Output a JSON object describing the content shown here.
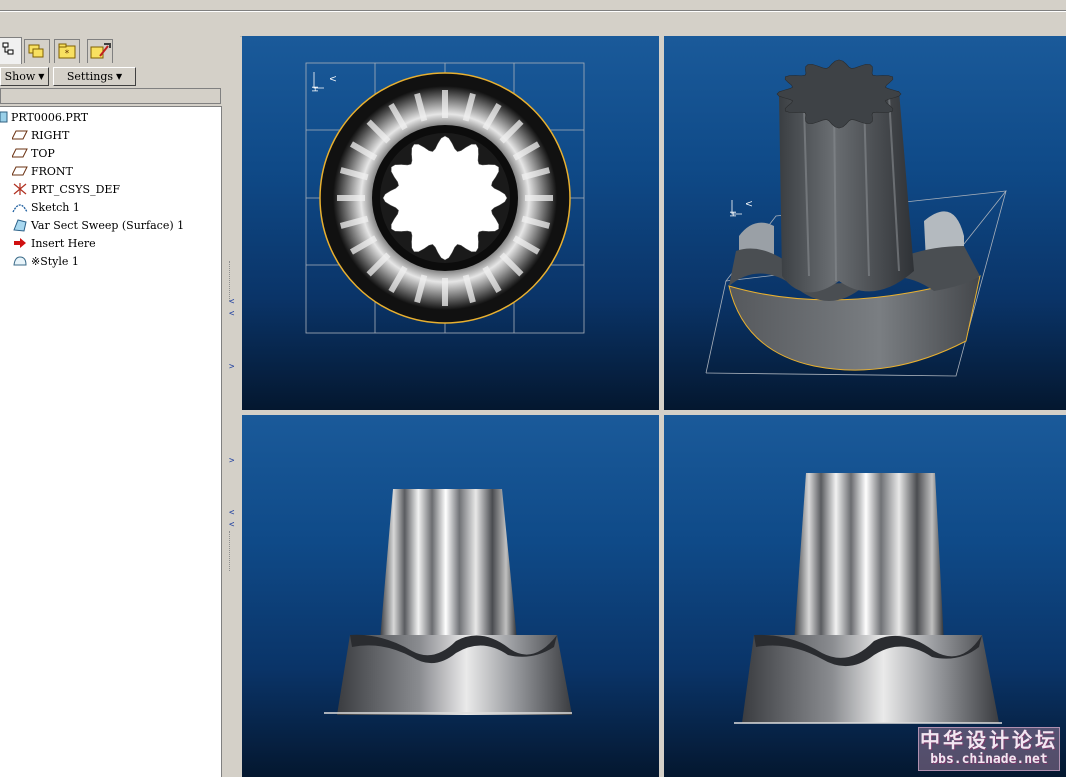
{
  "toolbar": {
    "show_label": "Show",
    "settings_label": "Settings"
  },
  "tabs": [
    {
      "name": "model-tree-tab-icon",
      "active": true
    },
    {
      "name": "layers-tab-icon",
      "active": false
    },
    {
      "name": "favorites-tab-icon",
      "active": false
    },
    {
      "name": "tools-tab-icon",
      "active": false
    }
  ],
  "model_tree": {
    "root": "PRT0006.PRT",
    "items": [
      {
        "label": "RIGHT",
        "icon": "datum-plane-icon"
      },
      {
        "label": "TOP",
        "icon": "datum-plane-icon"
      },
      {
        "label": "FRONT",
        "icon": "datum-plane-icon"
      },
      {
        "label": "PRT_CSYS_DEF",
        "icon": "coordinate-system-icon"
      },
      {
        "label": "Sketch 1",
        "icon": "sketch-icon"
      },
      {
        "label": "Var Sect Sweep (Surface) 1",
        "icon": "sweep-surface-icon"
      },
      {
        "label": "Insert Here",
        "icon": "insert-arrow-icon"
      },
      {
        "label": "※Style 1",
        "icon": "style-feature-icon"
      }
    ]
  },
  "viewports": {
    "top_left": {
      "grid_label_v": "V",
      "grid_label_h": "H"
    },
    "top_right": {
      "grid_label_v": "V",
      "grid_label_h": "H"
    }
  },
  "colors": {
    "viewport_top": "#1a5a9a",
    "viewport_bottom": "#04172f",
    "edge_highlight": "#e8b030",
    "grid": "#9aa6b4"
  },
  "watermark": {
    "chinese": "中华设计论坛",
    "url": "bbs.chinade.net"
  }
}
